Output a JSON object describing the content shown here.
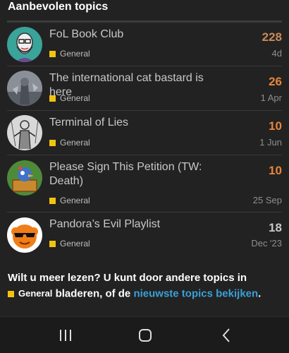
{
  "section": {
    "title": "Aanbevolen topics"
  },
  "colors": {
    "category_general": "#f1c40f",
    "hot_replies": "#e8843c",
    "warm_replies": "#c98a5a",
    "normal_replies": "#c8c8c8",
    "link": "#3aa0d8"
  },
  "topics": [
    {
      "title": "FoL Book Club",
      "category": "General",
      "replies": "228",
      "activity": "4d",
      "avatar_icon": "bearded-man-avatar-icon"
    },
    {
      "title": "The international cat bastard is here",
      "category": "General",
      "replies": "26",
      "activity": "1 Apr",
      "avatar_icon": "statue-avatar-icon"
    },
    {
      "title": "Terminal of Lies",
      "category": "General",
      "replies": "10",
      "activity": "1 Jun",
      "avatar_icon": "sketch-figure-avatar-icon"
    },
    {
      "title": "Please Sign This Petition (TW: Death)",
      "category": "General",
      "replies": "10",
      "activity": "25 Sep",
      "avatar_icon": "cartoon-bird-avatar-icon"
    },
    {
      "title": "Pandora’s Evil Playlist",
      "category": "General",
      "replies": "18",
      "activity": "Dec '23",
      "avatar_icon": "sunglasses-avatar-icon"
    }
  ],
  "footer": {
    "text_before": "Wilt u meer lezen? U kunt door andere topics in",
    "category": "General",
    "text_middle": "bladeren, of de",
    "link": "nieuwste topics bekijken",
    "text_end": "."
  },
  "navbar": {
    "recent_icon": "recent-apps-icon",
    "home_icon": "home-icon",
    "back_icon": "back-icon"
  }
}
